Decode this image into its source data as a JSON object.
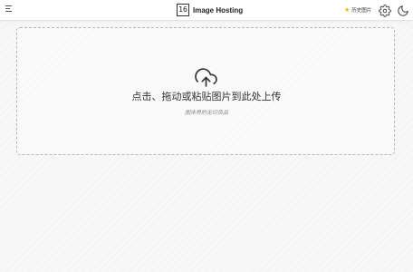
{
  "header": {
    "logo_text": "16",
    "title": "Image Hosting",
    "history_label": "历史图片"
  },
  "icons": {
    "menu": "menu-icon",
    "history": "star-icon",
    "settings": "gear-icon",
    "theme": "moon-icon",
    "upload": "cloud-upload-icon"
  },
  "upload": {
    "title": "点击、拖动或粘贴图片到此处上传",
    "subtitle": "图床界的无印良品"
  },
  "colors": {
    "accent_star": "#f2b705",
    "text": "#333333",
    "muted": "#888888",
    "border": "#b8b8b8"
  }
}
